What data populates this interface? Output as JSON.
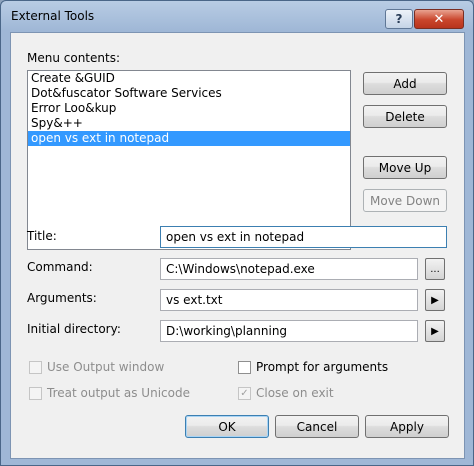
{
  "window": {
    "title": "External Tools",
    "help_label": "?",
    "close_label": "✕"
  },
  "menu_contents_label": "Menu contents:",
  "menu_items": [
    "Create &GUID",
    "Dot&fuscator Software Services",
    "Error Loo&kup",
    "Spy&++",
    "open vs ext in notepad"
  ],
  "selected_index": 4,
  "buttons": {
    "add": "Add",
    "delete": "Delete",
    "move_up": "Move Up",
    "move_down": "Move Down",
    "ok": "OK",
    "cancel": "Cancel",
    "apply": "Apply",
    "browse": "...",
    "arrow": "▶"
  },
  "fields": {
    "title_label": "Title:",
    "title_value": "open vs ext in notepad",
    "command_label": "Command:",
    "command_value": "C:\\Windows\\notepad.exe",
    "arguments_label": "Arguments:",
    "arguments_value": "vs ext.txt",
    "initial_dir_label": "Initial directory:",
    "initial_dir_value": "D:\\working\\planning"
  },
  "options": {
    "use_output_window": {
      "label": "Use Output window",
      "checked": false,
      "enabled": false
    },
    "prompt_for_arguments": {
      "label": "Prompt for arguments",
      "checked": false,
      "enabled": true
    },
    "treat_output_unicode": {
      "label": "Treat output as Unicode",
      "checked": false,
      "enabled": false
    },
    "close_on_exit": {
      "label": "Close on exit",
      "checked": true,
      "enabled": false
    }
  },
  "check_mark": "✓"
}
